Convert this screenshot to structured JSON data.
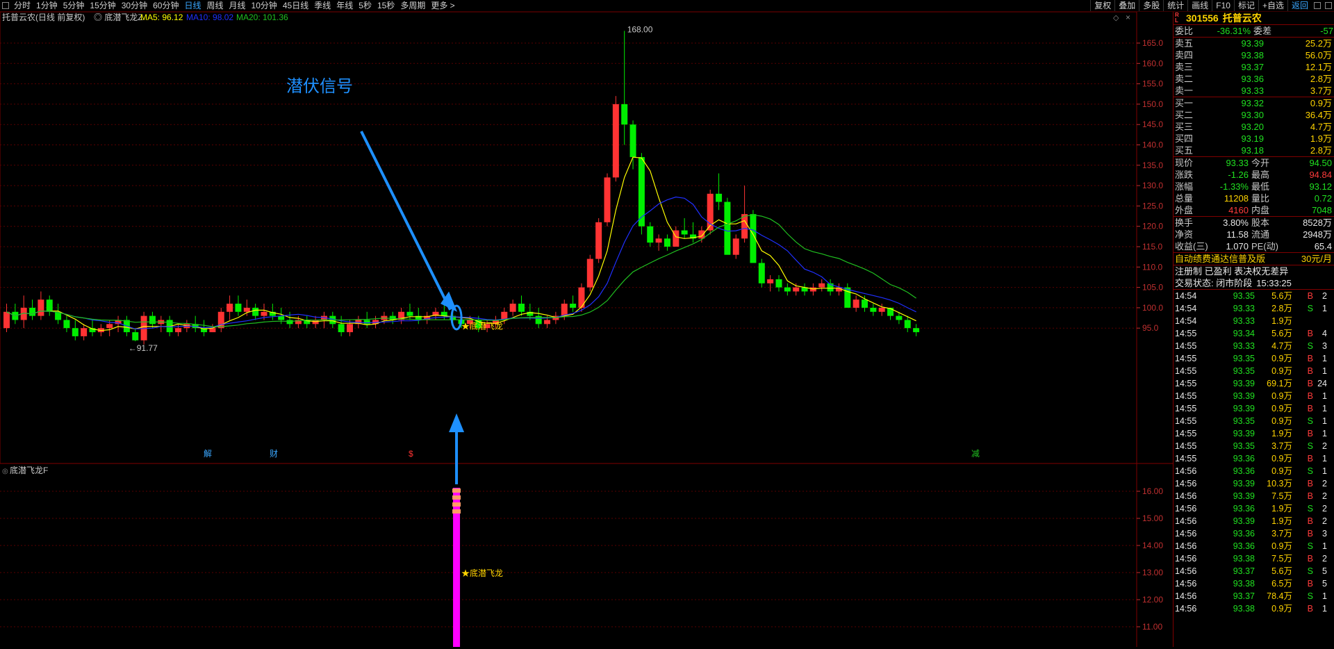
{
  "toolbar": {
    "periods": [
      "分时",
      "1分钟",
      "5分钟",
      "15分钟",
      "30分钟",
      "60分钟",
      "日线",
      "周线",
      "月线",
      "10分钟",
      "45日线",
      "季线",
      "年线",
      "5秒",
      "15秒",
      "多周期",
      "更多 >"
    ],
    "active_period": "日线",
    "right_buttons": [
      "复权",
      "叠加",
      "多股",
      "统计",
      "画线",
      "F10",
      "标记",
      "+自选",
      "返回"
    ]
  },
  "chart_header": {
    "stock": "托普云农(日线 前复权)",
    "indicator": "底潜飞龙Z",
    "ma5": "MA5: 96.12",
    "ma10": "MA10: 98.02",
    "ma20": "MA20: 101.36"
  },
  "colors": {
    "up": "#ff3333",
    "down": "#00ee00",
    "ma5": "#ffff00",
    "ma10": "#2030ff",
    "ma20": "#20c020",
    "accent": "#1e90ff",
    "signal": "#ff00ff"
  },
  "annotation": {
    "text": "潜伏信号"
  },
  "price_axis": {
    "labels": [
      "165.0",
      "160.0",
      "155.0",
      "150.0",
      "145.0",
      "140.0",
      "135.0",
      "130.0",
      "125.0",
      "120.0",
      "115.0",
      "110.0",
      "105.0",
      "100.0",
      "95.0"
    ]
  },
  "price_marks": {
    "high": "168.00",
    "low": "91.77",
    "signal": "★底潜飞龙"
  },
  "event_marks": [
    "解",
    "财",
    "$",
    "减"
  ],
  "sub_chart": {
    "title": "底潜飞龙F",
    "axis": [
      "16.00",
      "15.00",
      "14.00",
      "13.00",
      "12.00",
      "11.00"
    ],
    "signal_label": "★底潜飞龙"
  },
  "chart_data": {
    "type": "candlestick",
    "ohlc": [
      [
        95,
        101,
        94,
        99
      ],
      [
        99,
        101,
        96,
        97
      ],
      [
        97,
        103,
        95,
        100
      ],
      [
        100,
        102,
        97,
        98
      ],
      [
        98,
        104,
        97,
        102
      ],
      [
        102,
        103,
        98,
        99
      ],
      [
        99,
        101,
        96,
        97
      ],
      [
        97,
        98,
        94,
        95
      ],
      [
        95,
        97,
        92,
        93
      ],
      [
        93,
        96,
        92,
        95
      ],
      [
        95,
        97,
        93,
        94
      ],
      [
        94,
        96,
        93,
        95
      ],
      [
        95,
        97,
        93,
        96
      ],
      [
        96,
        98,
        94,
        97
      ],
      [
        97,
        98,
        93,
        94
      ],
      [
        94,
        95,
        91.77,
        92
      ],
      [
        92,
        99,
        91,
        98
      ],
      [
        98,
        99,
        95,
        96
      ],
      [
        96,
        98,
        94,
        97
      ],
      [
        97,
        98,
        93,
        94
      ],
      [
        94,
        96,
        93,
        95
      ],
      [
        95,
        97,
        94,
        96
      ],
      [
        96,
        98,
        94,
        95
      ],
      [
        95,
        97,
        93,
        94
      ],
      [
        94,
        96,
        94,
        95
      ],
      [
        95,
        100,
        94,
        99
      ],
      [
        99,
        103,
        97,
        101
      ],
      [
        101,
        103,
        98,
        99
      ],
      [
        99,
        102,
        98,
        100
      ],
      [
        100,
        101,
        97,
        98
      ],
      [
        98,
        101,
        97,
        99
      ],
      [
        99,
        101,
        97,
        98
      ],
      [
        98,
        100,
        96,
        97
      ],
      [
        97,
        99,
        95,
        96
      ],
      [
        96,
        98,
        95,
        97
      ],
      [
        97,
        98,
        95,
        96
      ],
      [
        96,
        98,
        95,
        97
      ],
      [
        97,
        99,
        95,
        98
      ],
      [
        98,
        99,
        95,
        96
      ],
      [
        96,
        98,
        93,
        94
      ],
      [
        94,
        97,
        93,
        96
      ],
      [
        96,
        98,
        95,
        97
      ],
      [
        97,
        99,
        95,
        96
      ],
      [
        96,
        98,
        95,
        97
      ],
      [
        97,
        99,
        96,
        98
      ],
      [
        98,
        99,
        96,
        97
      ],
      [
        97,
        100,
        96,
        99
      ],
      [
        99,
        101,
        97,
        98
      ],
      [
        98,
        100,
        96,
        97
      ],
      [
        97,
        99,
        96,
        98
      ],
      [
        98,
        100,
        97,
        99
      ],
      [
        99,
        101,
        97,
        98
      ],
      [
        98,
        100,
        96,
        97
      ],
      [
        97,
        99,
        95,
        96
      ],
      [
        96,
        98,
        95,
        97
      ],
      [
        97,
        98,
        94,
        95
      ],
      [
        95,
        97,
        94,
        96
      ],
      [
        96,
        98,
        95,
        97
      ],
      [
        97,
        100,
        96,
        99
      ],
      [
        99,
        102,
        98,
        101
      ],
      [
        101,
        103,
        98,
        99
      ],
      [
        99,
        101,
        97,
        98
      ],
      [
        98,
        100,
        95,
        96
      ],
      [
        96,
        98,
        95,
        97
      ],
      [
        97,
        99,
        96,
        98
      ],
      [
        98,
        102,
        97,
        101
      ],
      [
        101,
        103,
        99,
        100
      ],
      [
        100,
        106,
        99,
        105
      ],
      [
        105,
        113,
        104,
        112
      ],
      [
        112,
        122,
        111,
        121
      ],
      [
        121,
        133,
        120,
        132
      ],
      [
        132,
        152,
        131,
        150
      ],
      [
        150,
        168,
        140,
        145
      ],
      [
        145,
        146,
        134,
        137
      ],
      [
        137,
        138,
        118,
        120
      ],
      [
        120,
        121,
        115,
        116
      ],
      [
        116,
        118,
        114,
        117
      ],
      [
        117,
        118,
        114,
        115
      ],
      [
        115,
        120,
        115,
        119
      ],
      [
        119,
        122,
        117,
        118
      ],
      [
        118,
        121,
        116,
        117
      ],
      [
        117,
        120,
        116,
        119
      ],
      [
        119,
        129,
        118,
        128
      ],
      [
        128,
        133,
        124,
        126
      ],
      [
        126,
        127,
        114,
        113
      ],
      [
        113,
        118,
        112,
        117
      ],
      [
        117,
        130,
        116,
        123
      ],
      [
        123,
        124,
        112,
        111
      ],
      [
        111,
        112,
        105,
        106
      ],
      [
        106,
        108,
        104,
        107
      ],
      [
        107,
        108,
        104,
        105
      ],
      [
        105,
        106,
        103,
        104
      ],
      [
        104,
        106,
        103,
        105
      ],
      [
        105,
        106,
        103,
        104
      ],
      [
        104,
        106,
        103,
        105
      ],
      [
        105,
        107,
        104,
        106
      ],
      [
        106,
        107,
        103,
        104
      ],
      [
        104,
        106,
        103,
        105
      ],
      [
        105,
        106,
        101,
        100
      ],
      [
        100,
        103,
        99,
        102
      ],
      [
        102,
        103,
        99,
        100
      ],
      [
        100,
        101,
        98,
        99
      ],
      [
        99,
        101,
        98,
        100
      ],
      [
        100,
        100,
        97,
        98
      ],
      [
        98,
        99,
        96,
        97
      ],
      [
        97,
        98,
        94,
        95
      ],
      [
        95,
        96,
        93,
        94
      ]
    ]
  },
  "quote": {
    "code": "301556",
    "name": "托普云农",
    "webi": {
      "label": "委比",
      "value": "-36.31%",
      "label2": "委差",
      "value2": "-57"
    },
    "asks": [
      {
        "label": "卖五",
        "price": "93.39",
        "vol": "25.2万"
      },
      {
        "label": "卖四",
        "price": "93.38",
        "vol": "56.0万"
      },
      {
        "label": "卖三",
        "price": "93.37",
        "vol": "12.1万"
      },
      {
        "label": "卖二",
        "price": "93.36",
        "vol": "2.8万"
      },
      {
        "label": "卖一",
        "price": "93.33",
        "vol": "3.7万"
      }
    ],
    "bids": [
      {
        "label": "买一",
        "price": "93.32",
        "vol": "0.9万"
      },
      {
        "label": "买二",
        "price": "93.30",
        "vol": "36.4万"
      },
      {
        "label": "买三",
        "price": "93.20",
        "vol": "4.7万"
      },
      {
        "label": "买四",
        "price": "93.19",
        "vol": "1.9万"
      },
      {
        "label": "买五",
        "price": "93.18",
        "vol": "2.8万"
      }
    ],
    "stats": [
      {
        "l1": "现价",
        "v1": "93.33",
        "c1": "green",
        "l2": "今开",
        "v2": "94.50",
        "c2": "green"
      },
      {
        "l1": "涨跌",
        "v1": "-1.26",
        "c1": "green",
        "l2": "最高",
        "v2": "94.84",
        "c2": "red"
      },
      {
        "l1": "涨幅",
        "v1": "-1.33%",
        "c1": "green",
        "l2": "最低",
        "v2": "93.12",
        "c2": "green"
      },
      {
        "l1": "总量",
        "v1": "11208",
        "c1": "yellow",
        "l2": "量比",
        "v2": "0.72",
        "c2": "green"
      },
      {
        "l1": "外盘",
        "v1": "4160",
        "c1": "red",
        "l2": "内盘",
        "v2": "7048",
        "c2": "green"
      }
    ],
    "stats2": [
      {
        "l1": "换手",
        "v1": "3.80%",
        "l2": "股本",
        "v2": "8528万"
      },
      {
        "l1": "净资",
        "v1": "11.58",
        "l2": "流通",
        "v2": "2948万"
      },
      {
        "l1": "收益(三)",
        "v1": "1.070",
        "l2": "PE(动)",
        "v2": "65.4"
      }
    ],
    "news": {
      "text": "自动绩费通达信普及版",
      "price": "30元/月"
    },
    "notice": "注册制 已盈利 表决权无差异",
    "trade_state": {
      "label": "交易状态: 闭市阶段",
      "time": "15:33:25"
    },
    "ticks": [
      [
        "14:54",
        "93.35",
        "5.6万",
        "B",
        "2"
      ],
      [
        "14:54",
        "93.33",
        "2.8万",
        "S",
        "1"
      ],
      [
        "14:54",
        "93.33",
        "1.9万",
        "",
        ""
      ],
      [
        "14:55",
        "93.34",
        "5.6万",
        "B",
        "4"
      ],
      [
        "14:55",
        "93.33",
        "4.7万",
        "S",
        "3"
      ],
      [
        "14:55",
        "93.35",
        "0.9万",
        "B",
        "1"
      ],
      [
        "14:55",
        "93.35",
        "0.9万",
        "B",
        "1"
      ],
      [
        "14:55",
        "93.39",
        "69.1万",
        "B",
        "24"
      ],
      [
        "14:55",
        "93.39",
        "0.9万",
        "B",
        "1"
      ],
      [
        "14:55",
        "93.39",
        "0.9万",
        "B",
        "1"
      ],
      [
        "14:55",
        "93.35",
        "0.9万",
        "S",
        "1"
      ],
      [
        "14:55",
        "93.39",
        "1.9万",
        "B",
        "1"
      ],
      [
        "14:55",
        "93.35",
        "3.7万",
        "S",
        "2"
      ],
      [
        "14:55",
        "93.36",
        "0.9万",
        "B",
        "1"
      ],
      [
        "14:56",
        "93.36",
        "0.9万",
        "S",
        "1"
      ],
      [
        "14:56",
        "93.39",
        "10.3万",
        "B",
        "2"
      ],
      [
        "14:56",
        "93.39",
        "7.5万",
        "B",
        "2"
      ],
      [
        "14:56",
        "93.36",
        "1.9万",
        "S",
        "2"
      ],
      [
        "14:56",
        "93.39",
        "1.9万",
        "B",
        "2"
      ],
      [
        "14:56",
        "93.36",
        "3.7万",
        "B",
        "3"
      ],
      [
        "14:56",
        "93.36",
        "0.9万",
        "S",
        "1"
      ],
      [
        "14:56",
        "93.38",
        "7.5万",
        "B",
        "2"
      ],
      [
        "14:56",
        "93.37",
        "5.6万",
        "S",
        "5"
      ],
      [
        "14:56",
        "93.38",
        "6.5万",
        "B",
        "5"
      ],
      [
        "14:56",
        "93.37",
        "78.4万",
        "S",
        "1"
      ],
      [
        "14:56",
        "93.38",
        "0.9万",
        "B",
        "1"
      ]
    ]
  }
}
